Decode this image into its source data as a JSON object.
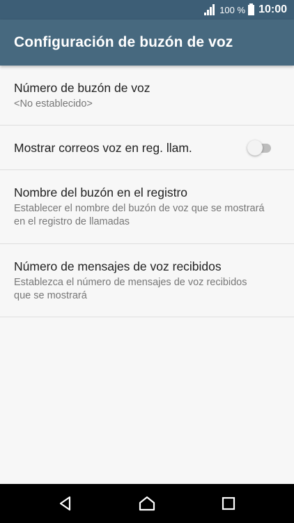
{
  "status_bar": {
    "battery_level": "100 %",
    "time": "10:00"
  },
  "app_bar": {
    "title": "Configuración de buzón de voz"
  },
  "settings": {
    "items": [
      {
        "title": "Número de buzón de voz",
        "subtitle": "<No establecido>"
      },
      {
        "title": "Mostrar correos voz en reg. llam.",
        "toggle_on": false
      },
      {
        "title": "Nombre del buzón en el registro",
        "subtitle": "Establecer el nombre del buzón de voz que se mostrará en el registro de llamadas"
      },
      {
        "title": "Número de mensajes de voz recibidos",
        "subtitle": "Establezca el número de mensajes de voz recibidos que se mostrará"
      }
    ]
  },
  "nav_bar": {
    "icons": [
      "back-icon",
      "home-icon",
      "recent-apps-icon"
    ]
  },
  "colors": {
    "status_bar": "#3d5e76",
    "app_bar": "#47697f",
    "background": "#f7f7f7",
    "divider": "#dedede",
    "toggle_off_track": "#bdbdbd"
  }
}
